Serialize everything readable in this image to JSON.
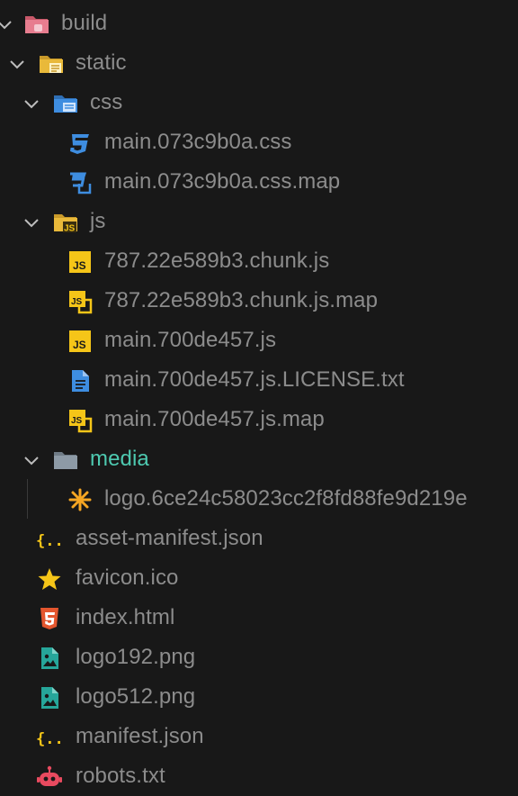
{
  "colors": {
    "background": "#181818",
    "text": "#8c8c8c",
    "folder_highlight_text": "#4ec9b0",
    "js_yellow": "#f5c518",
    "css_blue": "#3e8de0",
    "html_red": "#e4562e",
    "image_teal": "#26a69a",
    "robot_red": "#e84a5f",
    "build_folder": "#e77d8f",
    "static_folder": "#e9b93a",
    "media_folder": "#8d9aa6"
  },
  "tree": {
    "build": {
      "label": "build",
      "icon": "folder-open-icon"
    },
    "static": {
      "label": "static",
      "icon": "folder-open-icon"
    },
    "css": {
      "label": "css",
      "icon": "folder-open-icon"
    },
    "css_main": {
      "label": "main.073c9b0a.css",
      "icon": "css-icon"
    },
    "css_main_map": {
      "label": "main.073c9b0a.css.map",
      "icon": "css-map-icon"
    },
    "js": {
      "label": "js",
      "icon": "folder-open-icon"
    },
    "chunk": {
      "label": "787.22e589b3.chunk.js",
      "icon": "js-icon"
    },
    "chunk_map": {
      "label": "787.22e589b3.chunk.js.map",
      "icon": "js-map-icon"
    },
    "main_js": {
      "label": "main.700de457.js",
      "icon": "js-icon"
    },
    "main_license": {
      "label": "main.700de457.js.LICENSE.txt",
      "icon": "text-file-icon"
    },
    "main_js_map": {
      "label": "main.700de457.js.map",
      "icon": "js-map-icon"
    },
    "media": {
      "label": "media",
      "icon": "folder-open-icon"
    },
    "logo_svg": {
      "label": "logo.6ce24c58023cc2f8fd88fe9d219e",
      "icon": "svg-asterisk-icon"
    },
    "asset_manifest": {
      "label": "asset-manifest.json",
      "icon": "json-icon"
    },
    "favicon": {
      "label": "favicon.ico",
      "icon": "star-icon"
    },
    "index_html": {
      "label": "index.html",
      "icon": "html5-icon"
    },
    "logo192": {
      "label": "logo192.png",
      "icon": "image-icon"
    },
    "logo512": {
      "label": "logo512.png",
      "icon": "image-icon"
    },
    "manifest": {
      "label": "manifest.json",
      "icon": "json-icon"
    },
    "robots": {
      "label": "robots.txt",
      "icon": "robot-icon"
    }
  }
}
